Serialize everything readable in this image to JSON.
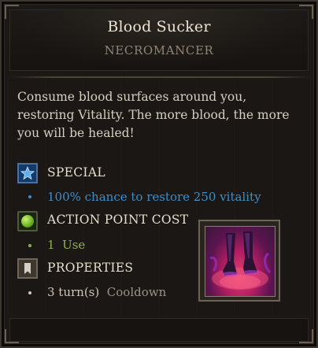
{
  "skill": {
    "title": "Blood Sucker",
    "school": "NECROMANCER",
    "description": "Consume blood surfaces around you, restoring Vitality. The more blood, the more you will be healed!",
    "icon": "blood-sucker-skill-icon"
  },
  "special": {
    "heading": "SPECIAL",
    "icon": "star-icon",
    "text": "100% chance to restore 250 vitality",
    "color": "#3f8ec9"
  },
  "ap_cost": {
    "heading": "ACTION POINT COST",
    "icon": "green-orb-icon",
    "value": "1",
    "unit": "Use",
    "color": "#8fb24a"
  },
  "properties": {
    "heading": "PROPERTIES",
    "icon": "bookmark-icon",
    "value": "3 turn(s)",
    "label": "Cooldown"
  }
}
